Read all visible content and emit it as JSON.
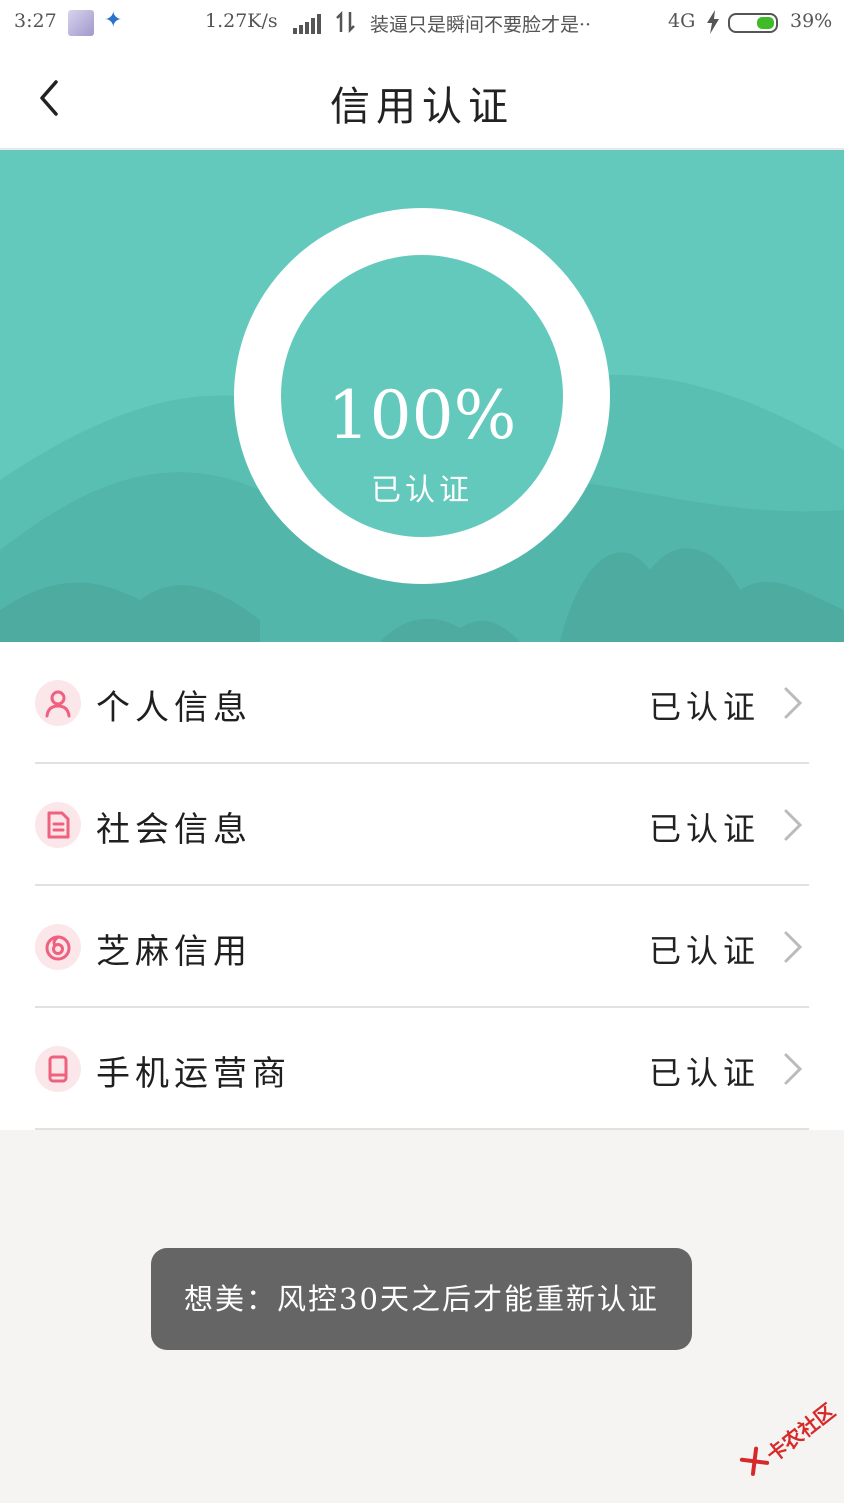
{
  "status_bar": {
    "time": "3:27",
    "net_speed": "1.27K/s",
    "notification": "装逼只是瞬间不要脸才是··",
    "network_type": "4G",
    "battery": "39%",
    "battery_level": 0.39,
    "battery_color": "#3fbb2a"
  },
  "header": {
    "title": "信用认证",
    "back_icon": "chevron-left-icon"
  },
  "hero": {
    "percent": "100%",
    "label": "已认证",
    "background_color": "#62c9bc",
    "progress": 1.0
  },
  "items": [
    {
      "label": "个人信息",
      "status": "已认证",
      "icon": "person-icon"
    },
    {
      "label": "社会信息",
      "status": "已认证",
      "icon": "document-icon"
    },
    {
      "label": "芝麻信用",
      "status": "已认证",
      "icon": "sesame-credit-icon"
    },
    {
      "label": "手机运营商",
      "status": "已认证",
      "icon": "phone-icon"
    }
  ],
  "toast": {
    "text": "想美：风控30天之后才能重新认证"
  },
  "watermark": {
    "text": "卡农社区"
  },
  "colors": {
    "accent_pink": "#f0607f",
    "icon_bg": "#fbe6ea",
    "chevron": "#bbbbbb"
  }
}
